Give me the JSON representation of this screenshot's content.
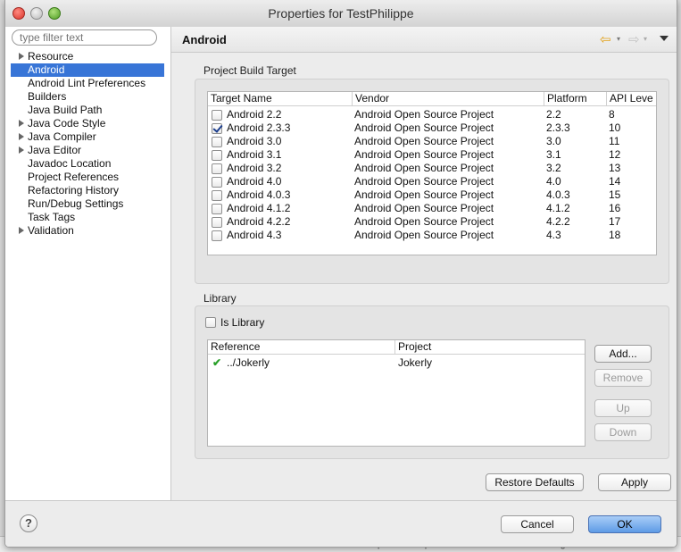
{
  "window": {
    "title": "Properties for TestPhilippe"
  },
  "background": {
    "console_line": "D  09-11 11:13:32.290  22080  22080  com.example.testp  dalvikvm       Late-enabling Che"
  },
  "filter": {
    "placeholder": "type filter text"
  },
  "tree": [
    {
      "label": "Resource",
      "expandable": true,
      "selected": false
    },
    {
      "label": "Android",
      "expandable": false,
      "selected": true
    },
    {
      "label": "Android Lint Preferences",
      "expandable": false,
      "selected": false
    },
    {
      "label": "Builders",
      "expandable": false,
      "selected": false
    },
    {
      "label": "Java Build Path",
      "expandable": false,
      "selected": false
    },
    {
      "label": "Java Code Style",
      "expandable": true,
      "selected": false
    },
    {
      "label": "Java Compiler",
      "expandable": true,
      "selected": false
    },
    {
      "label": "Java Editor",
      "expandable": true,
      "selected": false
    },
    {
      "label": "Javadoc Location",
      "expandable": false,
      "selected": false
    },
    {
      "label": "Project References",
      "expandable": false,
      "selected": false
    },
    {
      "label": "Refactoring History",
      "expandable": false,
      "selected": false
    },
    {
      "label": "Run/Debug Settings",
      "expandable": false,
      "selected": false
    },
    {
      "label": "Task Tags",
      "expandable": false,
      "selected": false
    },
    {
      "label": "Validation",
      "expandable": true,
      "selected": false
    }
  ],
  "page": {
    "title": "Android",
    "nav_icons": [
      "back-arrow-icon",
      "forward-arrow-icon",
      "view-menu-icon"
    ]
  },
  "build_target": {
    "label": "Project Build Target",
    "columns": [
      "Target Name",
      "Vendor",
      "Platform",
      "API Leve"
    ],
    "rows": [
      {
        "name": "Android 2.2",
        "vendor": "Android Open Source Project",
        "platform": "2.2",
        "api": "8",
        "checked": false
      },
      {
        "name": "Android 2.3.3",
        "vendor": "Android Open Source Project",
        "platform": "2.3.3",
        "api": "10",
        "checked": true
      },
      {
        "name": "Android 3.0",
        "vendor": "Android Open Source Project",
        "platform": "3.0",
        "api": "11",
        "checked": false
      },
      {
        "name": "Android 3.1",
        "vendor": "Android Open Source Project",
        "platform": "3.1",
        "api": "12",
        "checked": false
      },
      {
        "name": "Android 3.2",
        "vendor": "Android Open Source Project",
        "platform": "3.2",
        "api": "13",
        "checked": false
      },
      {
        "name": "Android 4.0",
        "vendor": "Android Open Source Project",
        "platform": "4.0",
        "api": "14",
        "checked": false
      },
      {
        "name": "Android 4.0.3",
        "vendor": "Android Open Source Project",
        "platform": "4.0.3",
        "api": "15",
        "checked": false
      },
      {
        "name": "Android 4.1.2",
        "vendor": "Android Open Source Project",
        "platform": "4.1.2",
        "api": "16",
        "checked": false
      },
      {
        "name": "Android 4.2.2",
        "vendor": "Android Open Source Project",
        "platform": "4.2.2",
        "api": "17",
        "checked": false
      },
      {
        "name": "Android 4.3",
        "vendor": "Android Open Source Project",
        "platform": "4.3",
        "api": "18",
        "checked": false
      }
    ]
  },
  "library": {
    "label": "Library",
    "is_library_label": "Is Library",
    "is_library_checked": false,
    "columns": [
      "Reference",
      "Project"
    ],
    "rows": [
      {
        "reference": "../Jokerly",
        "project": "Jokerly",
        "status_icon": "check-icon"
      }
    ],
    "buttons": {
      "add": "Add...",
      "remove": "Remove",
      "up": "Up",
      "down": "Down"
    }
  },
  "actions": {
    "restore_defaults": "Restore Defaults",
    "apply": "Apply"
  },
  "footer": {
    "help": "?",
    "cancel": "Cancel",
    "ok": "OK"
  },
  "colors": {
    "selection": "#3875d7",
    "default_button": "#5e9be6",
    "check_green": "#2aa02a"
  }
}
